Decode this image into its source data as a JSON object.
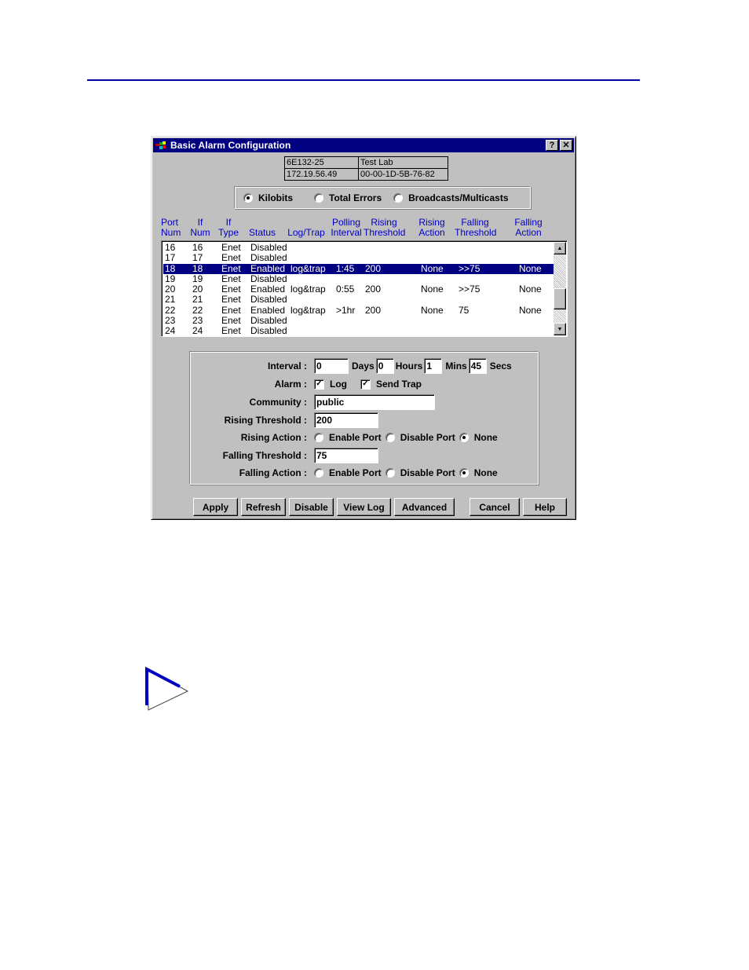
{
  "window": {
    "title": "Basic Alarm Configuration",
    "help_button": "?",
    "close_button": "✕"
  },
  "device_info": {
    "name": "6E132-25",
    "location": "Test Lab",
    "ip_address": "172.19.56.49",
    "mac_address": "00-00-1D-5B-76-82"
  },
  "statistic_type": {
    "options": [
      {
        "label": "Kilobits",
        "selected": true
      },
      {
        "label": "Total Errors",
        "selected": false
      },
      {
        "label": "Broadcasts/Multicasts",
        "selected": false
      }
    ]
  },
  "table": {
    "headers": [
      [
        "Port",
        "Num"
      ],
      [
        "If",
        "Num"
      ],
      [
        "If",
        "Type"
      ],
      [
        "",
        "Status"
      ],
      [
        "",
        "Log/Trap"
      ],
      [
        "Polling",
        "Interval"
      ],
      [
        "Rising",
        "Threshold"
      ],
      [
        "Rising",
        "Action"
      ],
      [
        "Falling",
        "Threshold"
      ],
      [
        "Falling",
        "Action"
      ]
    ],
    "rows": [
      {
        "port": "16",
        "if_num": "16",
        "if_type": "Enet",
        "status": "Disabled",
        "log_trap": "",
        "interval": "",
        "rising_threshold": "",
        "rising_action": "",
        "falling_threshold": "",
        "falling_action": "",
        "selected": false
      },
      {
        "port": "17",
        "if_num": "17",
        "if_type": "Enet",
        "status": "Disabled",
        "log_trap": "",
        "interval": "",
        "rising_threshold": "",
        "rising_action": "",
        "falling_threshold": "",
        "falling_action": "",
        "selected": false
      },
      {
        "port": "18",
        "if_num": "18",
        "if_type": "Enet",
        "status": "Enabled",
        "log_trap": "log&trap",
        "interval": "1:45",
        "rising_threshold": "200",
        "rising_action": "None",
        "falling_threshold": ">>75",
        "falling_action": "None",
        "selected": true
      },
      {
        "port": "19",
        "if_num": "19",
        "if_type": "Enet",
        "status": "Disabled",
        "log_trap": "",
        "interval": "",
        "rising_threshold": "",
        "rising_action": "",
        "falling_threshold": "",
        "falling_action": "",
        "selected": false
      },
      {
        "port": "20",
        "if_num": "20",
        "if_type": "Enet",
        "status": "Enabled",
        "log_trap": "log&trap",
        "interval": "0:55",
        "rising_threshold": "200",
        "rising_action": "None",
        "falling_threshold": ">>75",
        "falling_action": "None",
        "selected": false
      },
      {
        "port": "21",
        "if_num": "21",
        "if_type": "Enet",
        "status": "Disabled",
        "log_trap": "",
        "interval": "",
        "rising_threshold": "",
        "rising_action": "",
        "falling_threshold": "",
        "falling_action": "",
        "selected": false
      },
      {
        "port": "22",
        "if_num": "22",
        "if_type": "Enet",
        "status": "Enabled",
        "log_trap": "log&trap",
        "interval": ">1hr",
        "rising_threshold": "200",
        "rising_action": "None",
        "falling_threshold": "75",
        "falling_action": "None",
        "selected": false
      },
      {
        "port": "23",
        "if_num": "23",
        "if_type": "Enet",
        "status": "Disabled",
        "log_trap": "",
        "interval": "",
        "rising_threshold": "",
        "rising_action": "",
        "falling_threshold": "",
        "falling_action": "",
        "selected": false
      },
      {
        "port": "24",
        "if_num": "24",
        "if_type": "Enet",
        "status": "Disabled",
        "log_trap": "",
        "interval": "",
        "rising_threshold": "",
        "rising_action": "",
        "falling_threshold": "",
        "falling_action": "",
        "selected": false
      }
    ]
  },
  "form": {
    "interval": {
      "label": "Interval :",
      "days": "0",
      "days_label": "Days",
      "hours": "0",
      "hours_label": "Hours",
      "mins": "1",
      "mins_label": "Mins",
      "secs": "45",
      "secs_label": "Secs"
    },
    "alarm": {
      "label": "Alarm :",
      "log_label": "Log",
      "log_checked": true,
      "trap_label": "Send Trap",
      "trap_checked": true
    },
    "community": {
      "label": "Community :",
      "value": "public"
    },
    "rising_threshold": {
      "label": "Rising Threshold :",
      "value": "200"
    },
    "rising_action": {
      "label": "Rising Action :",
      "options": [
        {
          "label": "Enable Port",
          "selected": false
        },
        {
          "label": "Disable Port",
          "selected": false
        },
        {
          "label": "None",
          "selected": true
        }
      ]
    },
    "falling_threshold": {
      "label": "Falling Threshold :",
      "value": "75"
    },
    "falling_action": {
      "label": "Falling Action :",
      "options": [
        {
          "label": "Enable Port",
          "selected": false
        },
        {
          "label": "Disable Port",
          "selected": false
        },
        {
          "label": "None",
          "selected": true
        }
      ]
    }
  },
  "buttons": {
    "apply": "Apply",
    "refresh": "Refresh",
    "disable": "Disable",
    "view_log": "View Log",
    "advanced": "Advanced",
    "cancel": "Cancel",
    "help": "Help"
  },
  "colors": {
    "title_bar": "#000080",
    "header_text": "#0000c0",
    "selection": "#000080",
    "page_rule": "#0000a0"
  }
}
